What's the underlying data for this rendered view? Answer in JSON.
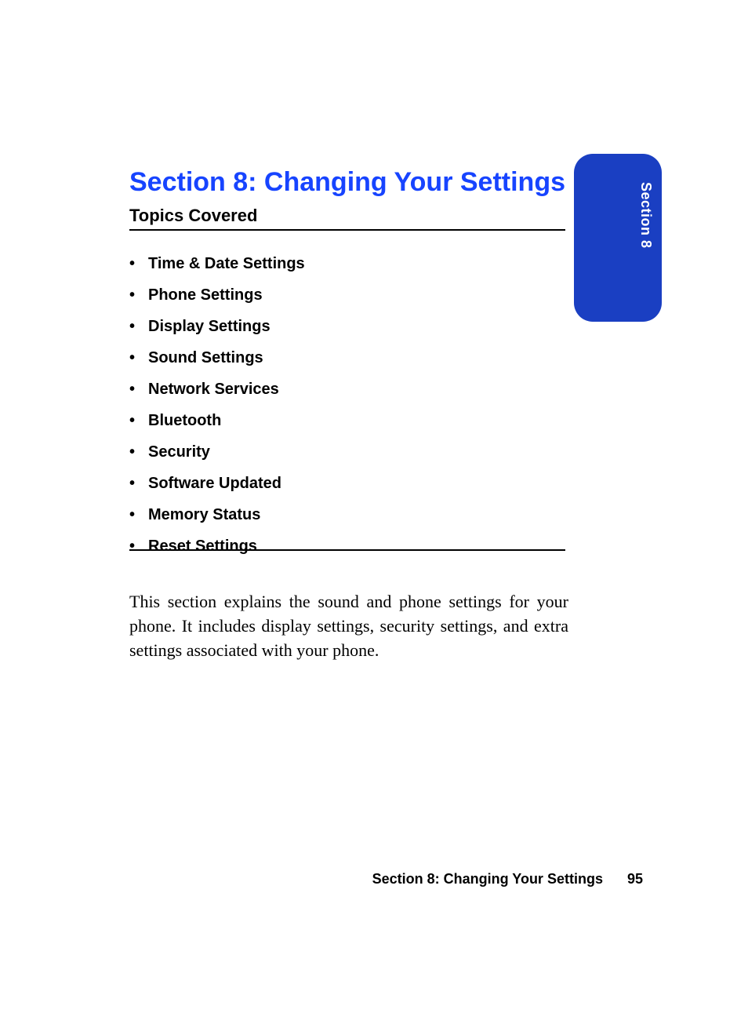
{
  "section": {
    "title": "Section 8: Changing Your Settings",
    "topics_heading": "Topics Covered",
    "topics": [
      "Time & Date Settings",
      "Phone Settings",
      "Display Settings",
      "Sound Settings",
      "Network Services",
      "Bluetooth",
      "Security",
      "Software Updated",
      "Memory Status",
      "Reset Settings"
    ],
    "intro": "This section explains the sound and phone settings for your phone. It includes display settings, security settings, and extra settings associated with your phone."
  },
  "side_tab": {
    "label": "Section 8"
  },
  "footer": {
    "text": "Section 8: Changing Your Settings",
    "page_number": "95"
  }
}
